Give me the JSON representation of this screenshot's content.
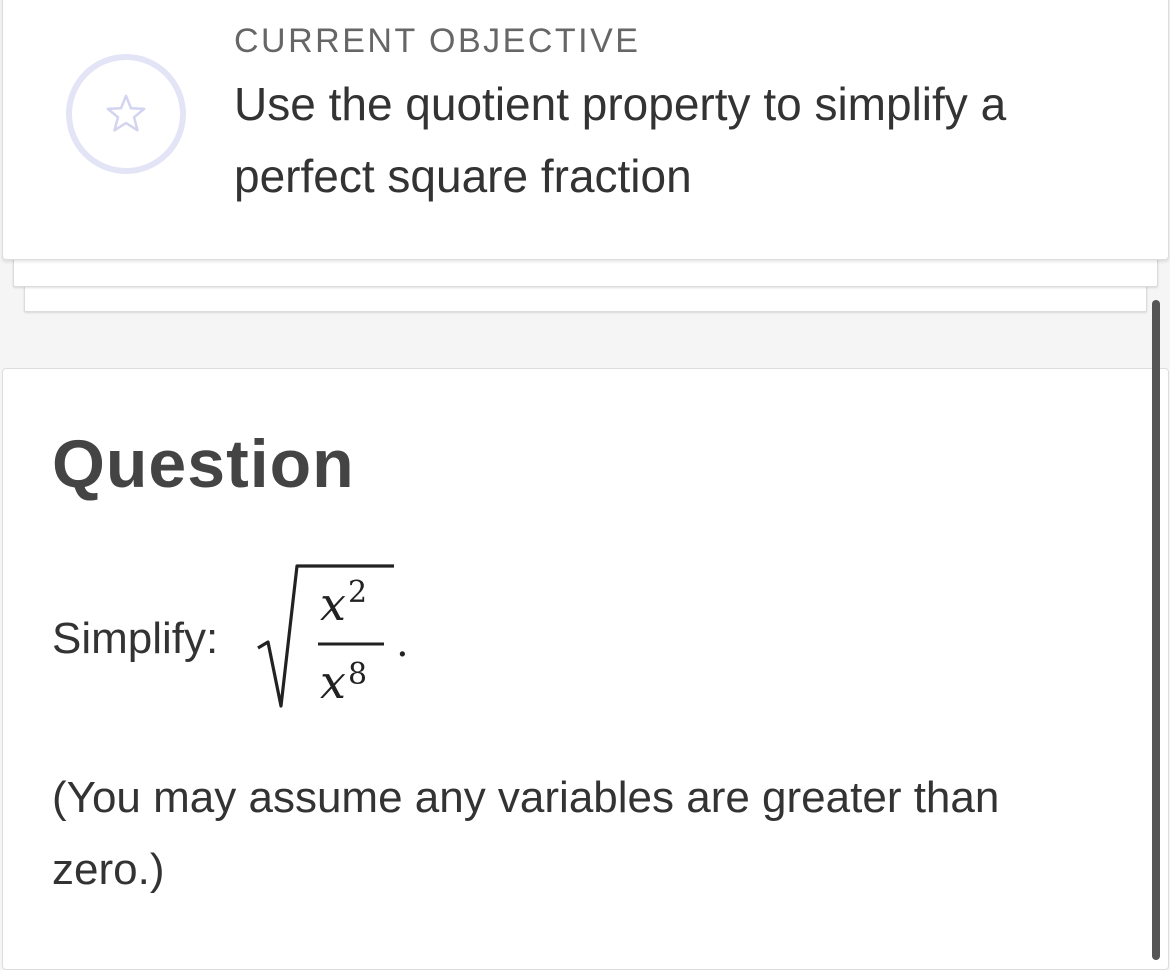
{
  "objective": {
    "badge_icon": "star-icon",
    "badge_color": "#e3e4f6",
    "label": "CURRENT OBJECTIVE",
    "text": "Use the quotient property to simplify a perfect square fraction"
  },
  "question": {
    "title": "Question",
    "prompt_label": "Simplify:",
    "expression": {
      "radical_icon": "square-root-icon",
      "numerator_base": "x",
      "numerator_exponent": "2",
      "denominator_base": "x",
      "denominator_exponent": "8",
      "trailing": "."
    },
    "note": "(You may assume any variables are greater than zero.)"
  }
}
